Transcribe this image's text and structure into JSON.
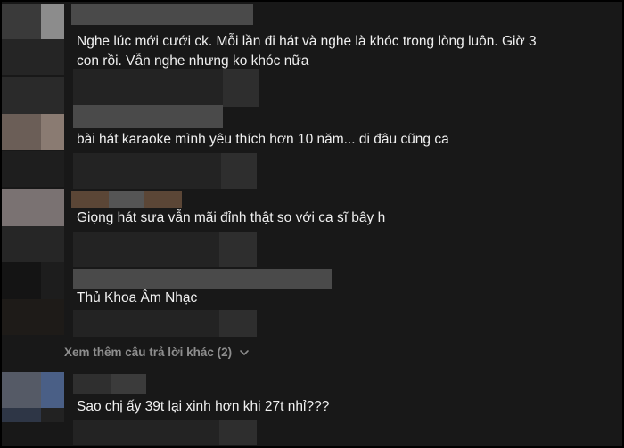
{
  "comments": [
    {
      "text_line1": "Nghe lúc mới cưới ck. Mỗi lần đi hát và nghe là khóc trong lòng luôn. Giờ 3",
      "text_line2": "con rồi. Vẫn nghe nhưng ko khóc nữa"
    },
    {
      "text": "bài hát karaoke mình yêu thích hơn 10 năm... di đâu cũng ca"
    },
    {
      "text": "Giọng hát sưa vẫn mãi đỉnh thật so với ca sĩ bây h"
    },
    {
      "text": "Thủ Khoa Âm Nhạc"
    },
    {
      "text": "Sao chị ấy 39t lại xinh hơn khi 27t nhỉ???"
    }
  ],
  "replies": {
    "more_label": "Xem thêm câu trả lời khác (2)",
    "icon": "chevron-down-icon"
  }
}
